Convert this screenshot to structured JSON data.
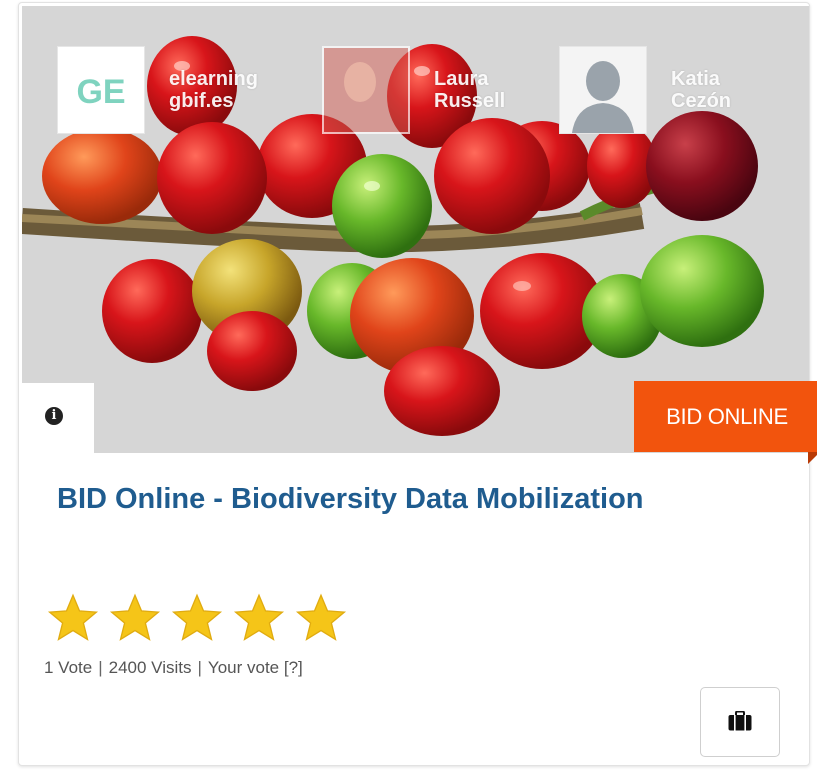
{
  "course_card": {
    "instructors": [
      {
        "name_line1": "elearning",
        "name_line2": "gbif.es",
        "logo_text": "GE"
      },
      {
        "name_line1": "Laura",
        "name_line2": "Russell"
      },
      {
        "name_line1": "Katia",
        "name_line2": "Cezón"
      }
    ],
    "info_icon": "info-circle-icon",
    "category_badge": "BID ONLINE",
    "title": "BID Online - Biodiversity Data Mobilization",
    "rating": {
      "stars_filled": 5,
      "stars_total": 5
    },
    "stats": {
      "votes": "1 Vote",
      "visits": "2400 Visits",
      "your_vote": "Your vote [?]",
      "separator": "|"
    },
    "action_icon": "briefcase-icon",
    "colors": {
      "badge": "#f2540d",
      "title": "#1f5c8f",
      "star": "#f5c518",
      "logo": "#7fd3bf"
    }
  }
}
